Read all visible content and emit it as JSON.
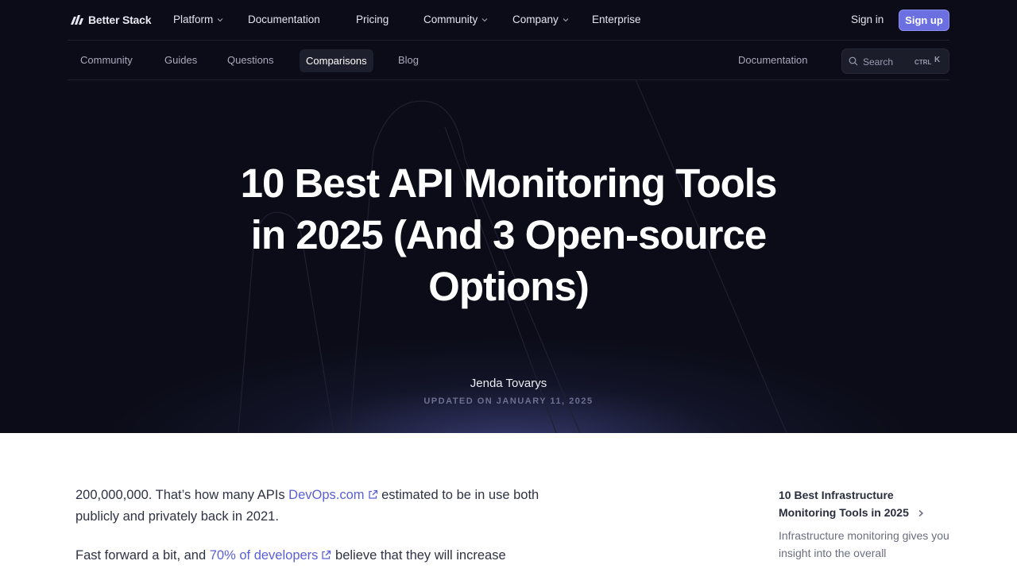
{
  "topnav": {
    "logo": "Better Stack",
    "items": [
      {
        "label": "Platform",
        "dropdown": true
      },
      {
        "label": "Documentation",
        "dropdown": false
      },
      {
        "label": "Pricing",
        "dropdown": false
      },
      {
        "label": "Community",
        "dropdown": true
      },
      {
        "label": "Company",
        "dropdown": true
      },
      {
        "label": "Enterprise",
        "dropdown": false
      }
    ],
    "signin": "Sign in",
    "signup": "Sign up"
  },
  "subnav": {
    "items": [
      "Community",
      "Guides",
      "Questions",
      "Comparisons",
      "Blog"
    ],
    "active": "Comparisons",
    "documentation": "Documentation",
    "search_placeholder": "Search",
    "shortcut_ctrl": "CTRL",
    "shortcut_key": "K"
  },
  "hero": {
    "title": "10 Best API Monitoring Tools in 2025 (And 3 Open-source Options)",
    "author": "Jenda Tovarys",
    "updated": "UPDATED ON JANUARY 11, 2025"
  },
  "article": {
    "p1_before": "200,000,000. That’s how many APIs ",
    "p1_link": "DevOps.com",
    "p1_after": " estimated to be in use both publicly and privately back in 2021.",
    "p2_before": "Fast forward a bit, and ",
    "p2_link": "70% of developers",
    "p2_after": " believe that they will increase"
  },
  "sidebar": {
    "title": "10 Best Infrastructure Monitoring Tools in 2025",
    "desc": "Infrastructure monitoring gives you insight into the overall"
  },
  "colors": {
    "hero_bg": "#0b0c17",
    "accent": "#6b6fe0",
    "link": "#5a5fd6"
  }
}
